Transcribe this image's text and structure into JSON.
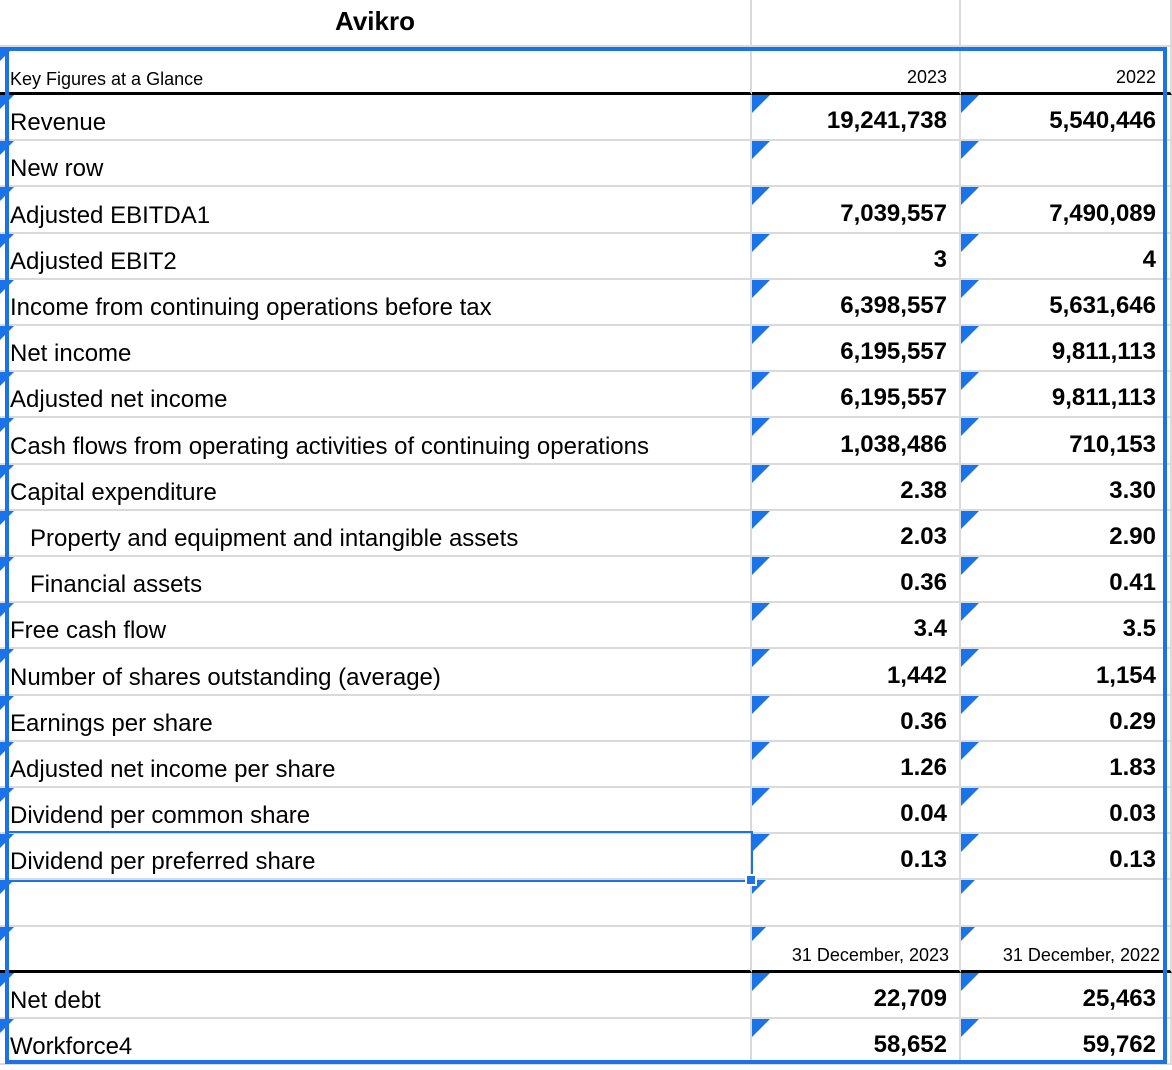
{
  "sheet": {
    "title": "Avikro",
    "header": {
      "label": "Key Figures at a Glance",
      "col_2023": "2023",
      "col_2022": "2022"
    },
    "rows": [
      {
        "label": "Revenue",
        "v2023": "19,241,738",
        "v2022": "5,540,446"
      },
      {
        "label": "New row",
        "v2023": "",
        "v2022": ""
      },
      {
        "label": "Adjusted EBITDA1",
        "v2023": "7,039,557",
        "v2022": "7,490,089"
      },
      {
        "label": "Adjusted EBIT2",
        "v2023": "3",
        "v2022": "4"
      },
      {
        "label": "Income from continuing operations before tax",
        "v2023": "6,398,557",
        "v2022": "5,631,646"
      },
      {
        "label": "Net income",
        "v2023": "6,195,557",
        "v2022": "9,811,113"
      },
      {
        "label": "Adjusted net income",
        "v2023": "6,195,557",
        "v2022": "9,811,113"
      },
      {
        "label": "Cash flows from operating activities of continuing operations",
        "v2023": "1,038,486",
        "v2022": "710,153"
      },
      {
        "label": "Capital expenditure",
        "v2023": "2.38",
        "v2022": "3.30"
      },
      {
        "label": "Property and equipment and intangible assets",
        "v2023": "2.03",
        "v2022": "2.90"
      },
      {
        "label": "Financial assets",
        "v2023": "0.36",
        "v2022": "0.41"
      },
      {
        "label": "Free cash flow",
        "v2023": "3.4",
        "v2022": "3.5"
      },
      {
        "label": "Number of shares outstanding (average)",
        "v2023": "1,442",
        "v2022": "1,154"
      },
      {
        "label": "Earnings per share",
        "v2023": "0.36",
        "v2022": "0.29"
      },
      {
        "label": "Adjusted net income per share",
        "v2023": "1.26",
        "v2022": "1.83"
      },
      {
        "label": "Dividend per common share",
        "v2023": "0.04",
        "v2022": "0.03"
      },
      {
        "label": "Dividend per preferred share",
        "v2023": "0.13",
        "v2022": "0.13"
      }
    ],
    "blank_row": {
      "label": "",
      "v2023": "",
      "v2022": ""
    },
    "date_header": {
      "label": "",
      "col_2023": "31 December, 2023",
      "col_2022": "31 December, 2022"
    },
    "bottom_rows": [
      {
        "label": "Net debt",
        "v2023": "22,709",
        "v2022": "25,463"
      },
      {
        "label": "Workforce4",
        "v2023": "58,652",
        "v2022": "59,762"
      }
    ]
  },
  "colors": {
    "accent": "#1a73e8",
    "grid": "#dadada"
  }
}
